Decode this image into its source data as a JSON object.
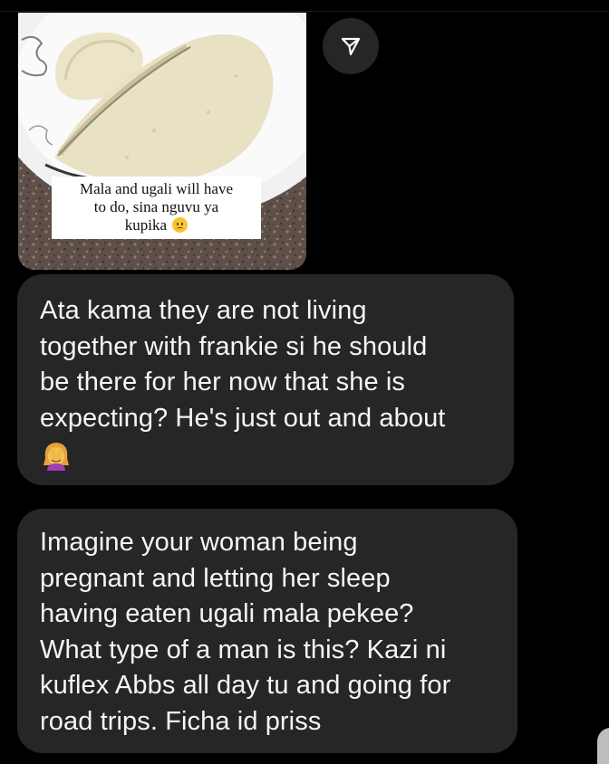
{
  "story": {
    "caption_line1": "Mala and ugali will have",
    "caption_line2": "to do, sina nguvu ya",
    "caption_line3": "kupika",
    "caption_emoji": "slightly-frowning-face-icon"
  },
  "share_button": {
    "icon": "send-icon"
  },
  "messages": [
    {
      "lines": [
        "Ata kama they are not living",
        "together with frankie si he should",
        "be there for her now that she is",
        "expecting? He's just out and about"
      ],
      "emoji": "woman-facepalming-icon"
    },
    {
      "lines": [
        "Imagine your woman being",
        "pregnant and letting her sleep",
        "having eaten ugali mala pekee?",
        "What type of a man is this? Kazi ni",
        "kuflex Abbs all day tu and going for",
        "road trips. Ficha id priss"
      ]
    }
  ],
  "colors": {
    "background": "#000000",
    "bubble": "#262626",
    "text": "#f5f5f5",
    "share_button": "#262626"
  }
}
